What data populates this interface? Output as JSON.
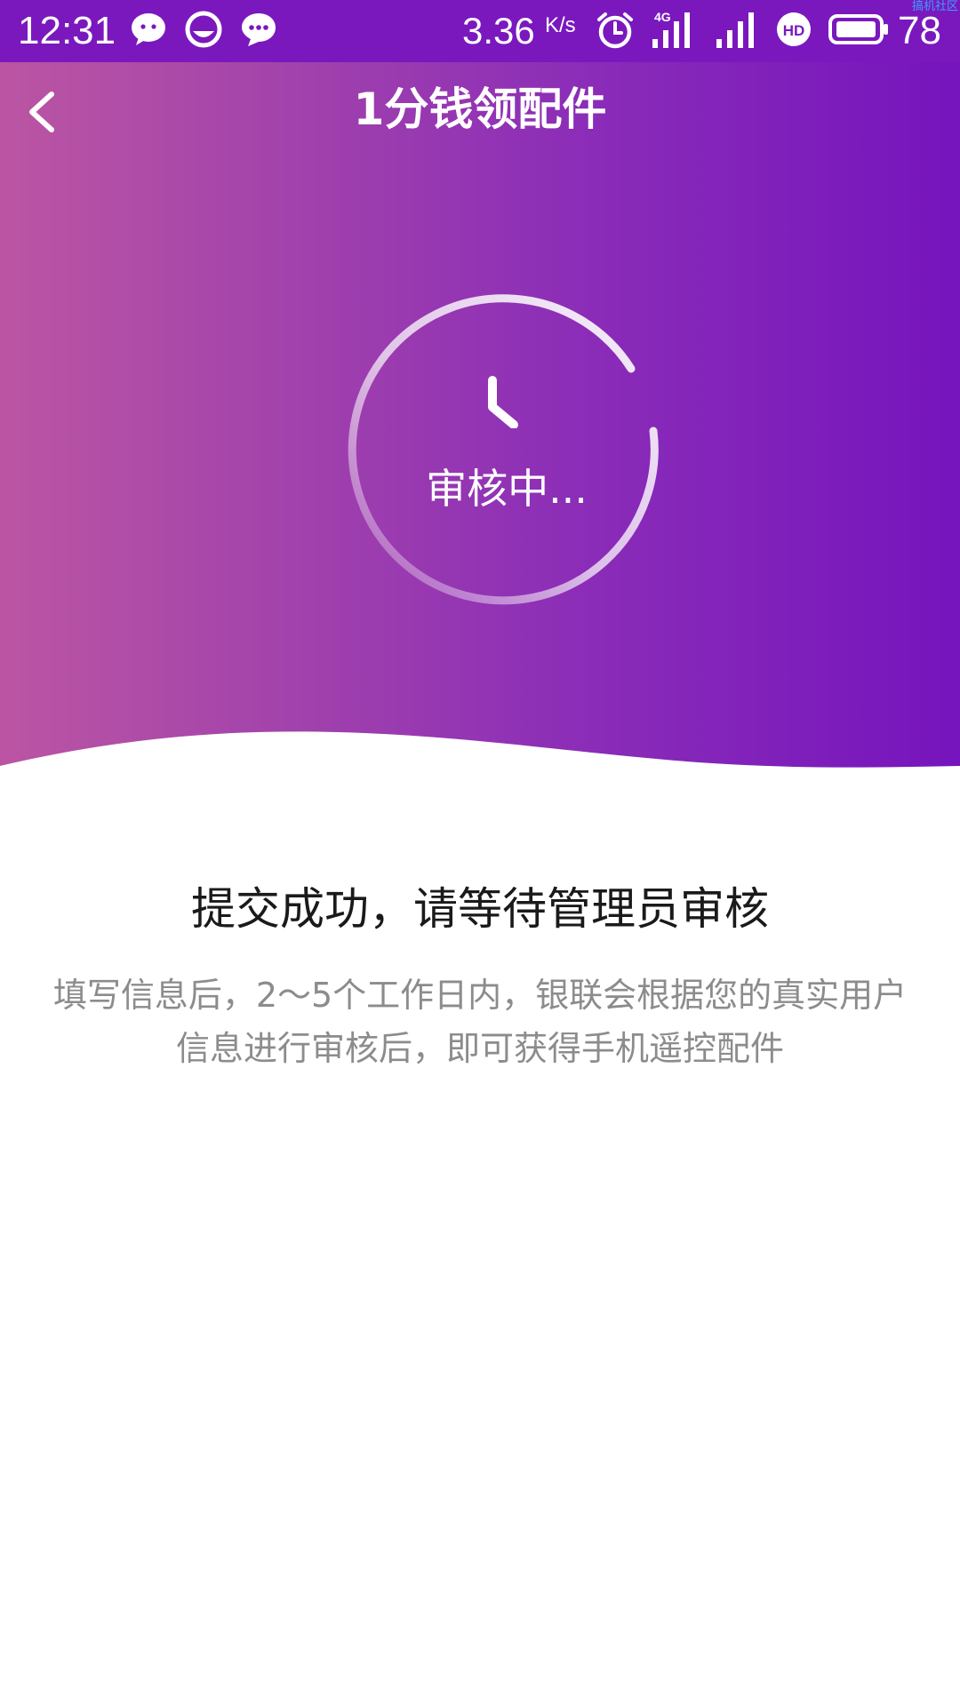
{
  "status_bar": {
    "time": "12:31",
    "net_speed": "3.36",
    "net_speed_unit": "K/s",
    "network_type": "4G",
    "battery_level": "78",
    "watermark": "搞机社区",
    "icons": [
      "wechat-icon",
      "qq-browser-icon",
      "message-icon",
      "alarm-icon",
      "signal-4g-icon",
      "signal-icon",
      "hd-icon",
      "battery-icon"
    ],
    "color": "#7a18be"
  },
  "header": {
    "title": "1分钱领配件",
    "back_icon": "back-arrow-icon"
  },
  "status_ring": {
    "label": "审核中...",
    "icon": "clock-icon"
  },
  "message": {
    "title": "提交成功，请等待管理员审核",
    "description_line1": "填写信息后，2～5个工作日内，银联会根据您的真实用户",
    "description_line2": "信息进行审核后，即可获得手机遥控配件"
  },
  "colors": {
    "gradient_start": "#bb55a3",
    "gradient_end": "#7614bd",
    "title_text": "#1a1a1a",
    "description_text": "#8c8c8c"
  }
}
